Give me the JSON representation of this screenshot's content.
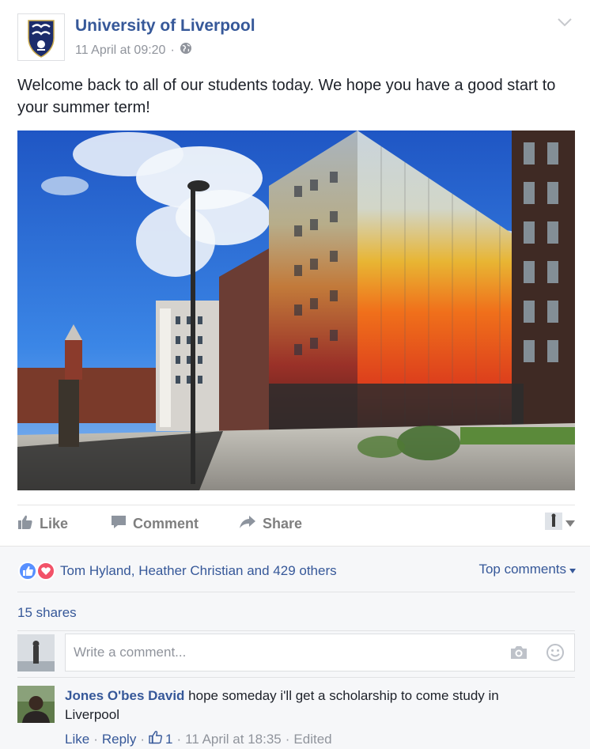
{
  "post": {
    "page_name": "University of Liverpool",
    "timestamp": "11 April at 09:20",
    "separator": "·",
    "privacy_icon": "globe-icon",
    "text": "Welcome back to all of our students today. We hope you have a good start to your summer term!"
  },
  "actions": {
    "like_label": "Like",
    "comment_label": "Comment",
    "share_label": "Share"
  },
  "reactions": {
    "summary": "Tom Hyland, Heather Christian and 429 others",
    "icons": [
      "like-icon",
      "love-icon"
    ],
    "like_color": "#5890ff",
    "love_color": "#f25268"
  },
  "sort": {
    "label": "Top comments"
  },
  "shares": {
    "label": "15 shares"
  },
  "composer": {
    "placeholder": "Write a comment..."
  },
  "comment": {
    "author": "Jones O'bes David",
    "text": " hope someday i'll get a scholarship to come study in Liverpool",
    "like_label": "Like",
    "reply_label": "Reply",
    "like_count": "1",
    "timestamp": "11 April at 18:35",
    "edited_label": "Edited",
    "separator": "·"
  },
  "colors": {
    "link": "#365899",
    "muted": "#90949c",
    "action_gray": "#7f7f7f",
    "panel_bg": "#f6f7f9"
  }
}
